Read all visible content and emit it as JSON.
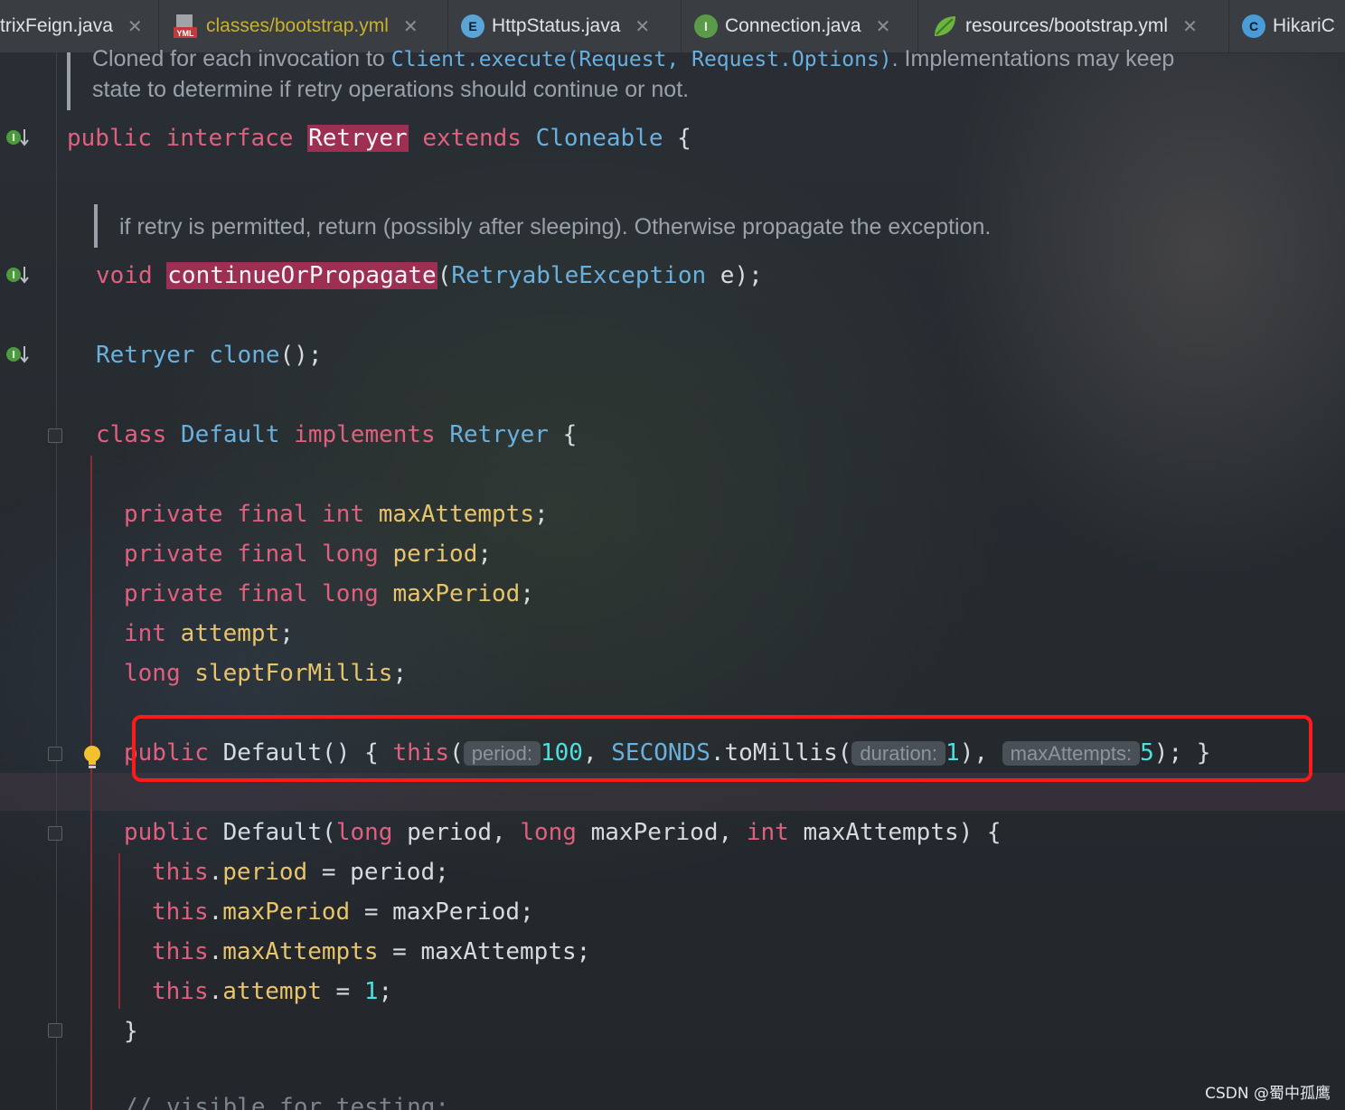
{
  "tabs": [
    {
      "label": "trixFeign.java",
      "icon": "none",
      "type": "java"
    },
    {
      "label": "classes/bootstrap.yml",
      "icon": "yml-file-icon",
      "type": "yml"
    },
    {
      "label": "HttpStatus.java",
      "icon": "enum-icon",
      "badge": "E",
      "type": "java"
    },
    {
      "label": "Connection.java",
      "icon": "interface-icon",
      "badge": "I",
      "type": "java"
    },
    {
      "label": "resources/bootstrap.yml",
      "icon": "spring-leaf-icon",
      "type": "yml"
    },
    {
      "label": "HikariC",
      "icon": "class-icon",
      "badge": "C",
      "type": "java"
    }
  ],
  "doc1": {
    "line1_prefix": "Cloned for each invocation to ",
    "line1_code": "Client.execute(Request, Request.Options)",
    "line1_suffix": ". Implementations may keep",
    "line2": "state to determine if retry operations should continue or not."
  },
  "iface": {
    "kw_public": "public",
    "kw_interface": "interface",
    "name": "Retryer",
    "kw_extends": "extends",
    "parent": "Cloneable",
    "brace": "{"
  },
  "doc2": "if retry is permitted, return (possibly after sleeping). Otherwise propagate the exception.",
  "method1": {
    "ret": "void",
    "name": "continueOrPropagate",
    "param_type": "RetryableException",
    "param_name": "e",
    "end": ");"
  },
  "method2": {
    "type": "Retryer",
    "name": "clone",
    "end": "();"
  },
  "cls": {
    "kw_class": "class",
    "name": "Default",
    "kw_impl": "implements",
    "iface": "Retryer",
    "brace": "{"
  },
  "fields": [
    {
      "mods": "private final ",
      "type": "int",
      "name": "maxAttempts"
    },
    {
      "mods": "private final ",
      "type": "long",
      "name": "period"
    },
    {
      "mods": "private final ",
      "type": "long",
      "name": "maxPeriod"
    },
    {
      "mods": "",
      "type": "int",
      "name": "attempt"
    },
    {
      "mods": "",
      "type": "long",
      "name": "sleptForMillis"
    }
  ],
  "ctor1": {
    "kw_public": "public",
    "name": "Default",
    "open": "() {",
    "kw_this": "this",
    "hint_period": "period:",
    "val_period": "100",
    "const": "SECONDS",
    "method": "toMillis",
    "hint_duration": "duration:",
    "val_duration": "1",
    "hint_max": "maxAttempts:",
    "val_max": "5",
    "close": "); }"
  },
  "ctor2": {
    "kw_public": "public",
    "name": "Default",
    "p1_type": "long",
    "p1": "period",
    "p2_type": "long",
    "p2": "maxPeriod",
    "p3_type": "int",
    "p3": "maxAttempts",
    "assigns": [
      {
        "field": "period",
        "value": "period",
        "numeric": false
      },
      {
        "field": "maxPeriod",
        "value": "maxPeriod",
        "numeric": false
      },
      {
        "field": "maxAttempts",
        "value": "maxAttempts",
        "numeric": false
      },
      {
        "field": "attempt",
        "value": "1",
        "numeric": true
      }
    ],
    "close_brace": "}"
  },
  "comment_tail": "// visible for testing;",
  "watermark": "CSDN @蜀中孤鹰",
  "colors": {
    "keyword": "#e0607e",
    "type": "#6ab0de",
    "field": "#e8c46a",
    "number": "#4de0e0",
    "highlight": "#9c2f52",
    "annotation_box": "#ff1a1a"
  }
}
